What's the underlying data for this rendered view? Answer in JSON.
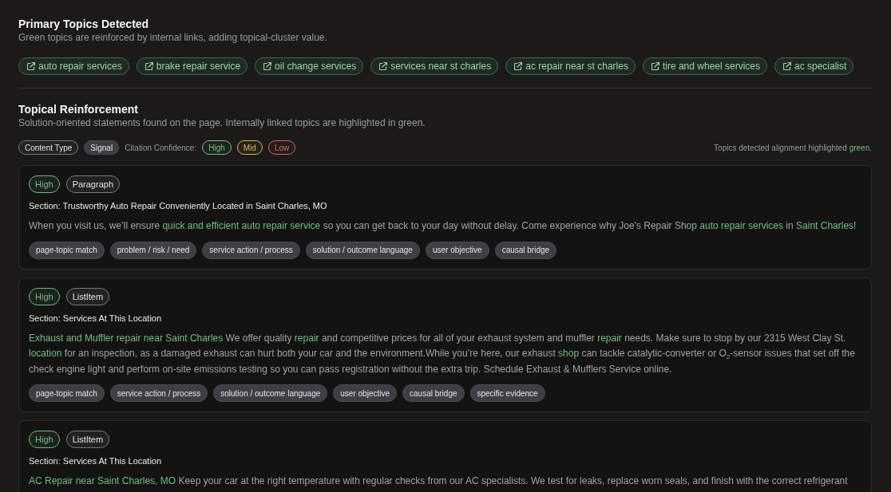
{
  "primary_topics": {
    "title": "Primary Topics Detected",
    "subtitle": "Green topics are reinforced by internal links, adding topical-cluster value.",
    "topics": [
      {
        "label": "auto repair services",
        "reinforced": true
      },
      {
        "label": "brake repair service",
        "reinforced": true
      },
      {
        "label": "oil change services",
        "reinforced": true
      },
      {
        "label": "services near st charles",
        "reinforced": true
      },
      {
        "label": "ac repair near st charles",
        "reinforced": true
      },
      {
        "label": "tire and wheel services",
        "reinforced": true
      },
      {
        "label": "ac specialist",
        "reinforced": true
      }
    ]
  },
  "topical_reinforcement": {
    "title": "Topical Reinforcement",
    "subtitle": "Solution-oriented statements found on the page. Internally linked topics are highlighted in green.",
    "legend": {
      "tags": [
        {
          "kind": "content_type",
          "label": "Content Type"
        },
        {
          "kind": "signal",
          "label": "Signal"
        }
      ],
      "confidence_label": "Citation Confidence:",
      "confidence_levels": [
        {
          "label": "High",
          "color": "#6fbf7f"
        },
        {
          "label": "Mid",
          "color": "#d9b54a"
        },
        {
          "label": "Low",
          "color": "#d46b5f"
        }
      ],
      "note": [
        {
          "kind": "text",
          "text": "Topics detected alignment highlighted "
        },
        {
          "kind": "highlight",
          "text": "green"
        },
        {
          "kind": "text",
          "text": "."
        }
      ]
    },
    "statements": [
      {
        "confidence": {
          "label": "High",
          "color": "#6fbf7f"
        },
        "content_type": "Paragraph",
        "section": "Section: Trustworthy Auto Repair Conveniently Located in Saint Charles, MO",
        "statement": [
          {
            "kind": "text",
            "text": "When you visit us, we’ll ensure "
          },
          {
            "kind": "highlight",
            "text": "quick and efficient auto repair service"
          },
          {
            "kind": "text",
            "text": " so you can get back to your day without delay. Come experience why Joe's Repair Shop "
          },
          {
            "kind": "highlight",
            "text": "auto repair services"
          },
          {
            "kind": "text",
            "text": " in "
          },
          {
            "kind": "highlight",
            "text": "Saint Charles"
          },
          {
            "kind": "text",
            "text": "!"
          }
        ],
        "signals": [
          "page-topic match",
          "problem / risk / need",
          "service action / process",
          "solution / outcome language",
          "user objective",
          "causal bridge"
        ]
      },
      {
        "confidence": {
          "label": "High",
          "color": "#6fbf7f"
        },
        "content_type": "ListItem",
        "section": "Section: Services At This Location",
        "statement": [
          {
            "kind": "highlight",
            "text": "Exhaust and Muffler repair near Saint Charles"
          },
          {
            "kind": "text",
            "text": " We offer quality "
          },
          {
            "kind": "highlight",
            "text": "repair"
          },
          {
            "kind": "text",
            "text": " and competitive prices for all of your exhaust system and muffler "
          },
          {
            "kind": "highlight",
            "text": "repair"
          },
          {
            "kind": "text",
            "text": " needs. Make sure to stop by our 2315 West Clay St. "
          },
          {
            "kind": "highlight",
            "text": "location"
          },
          {
            "kind": "text",
            "text": " for an inspection, as a damaged exhaust can hurt both your car and the environment.While you’re here, our exhaust "
          },
          {
            "kind": "highlight",
            "text": "shop"
          },
          {
            "kind": "text",
            "text": " can tackle catalytic-converter or O$_{2}$-sensor issues that set off the check engine light and perform on-site emissions testing so you can pass registration without the extra trip. Schedule Exhaust & Mufflers Service online."
          }
        ],
        "signals": [
          "page-topic match",
          "service action / process",
          "solution / outcome language",
          "user objective",
          "causal bridge",
          "specific evidence"
        ]
      },
      {
        "confidence": {
          "label": "High",
          "color": "#6fbf7f"
        },
        "content_type": "ListItem",
        "section": "Section: Services At This Location",
        "statement": [
          {
            "kind": "highlight",
            "text": "AC Repair near Saint Charles, MO"
          },
          {
            "kind": "text",
            "text": " Keep your car at the right temperature with regular checks from our AC specialists. We test for leaks, replace worn seals, and finish with the correct refrigerant"
          }
        ]
      }
    ]
  }
}
